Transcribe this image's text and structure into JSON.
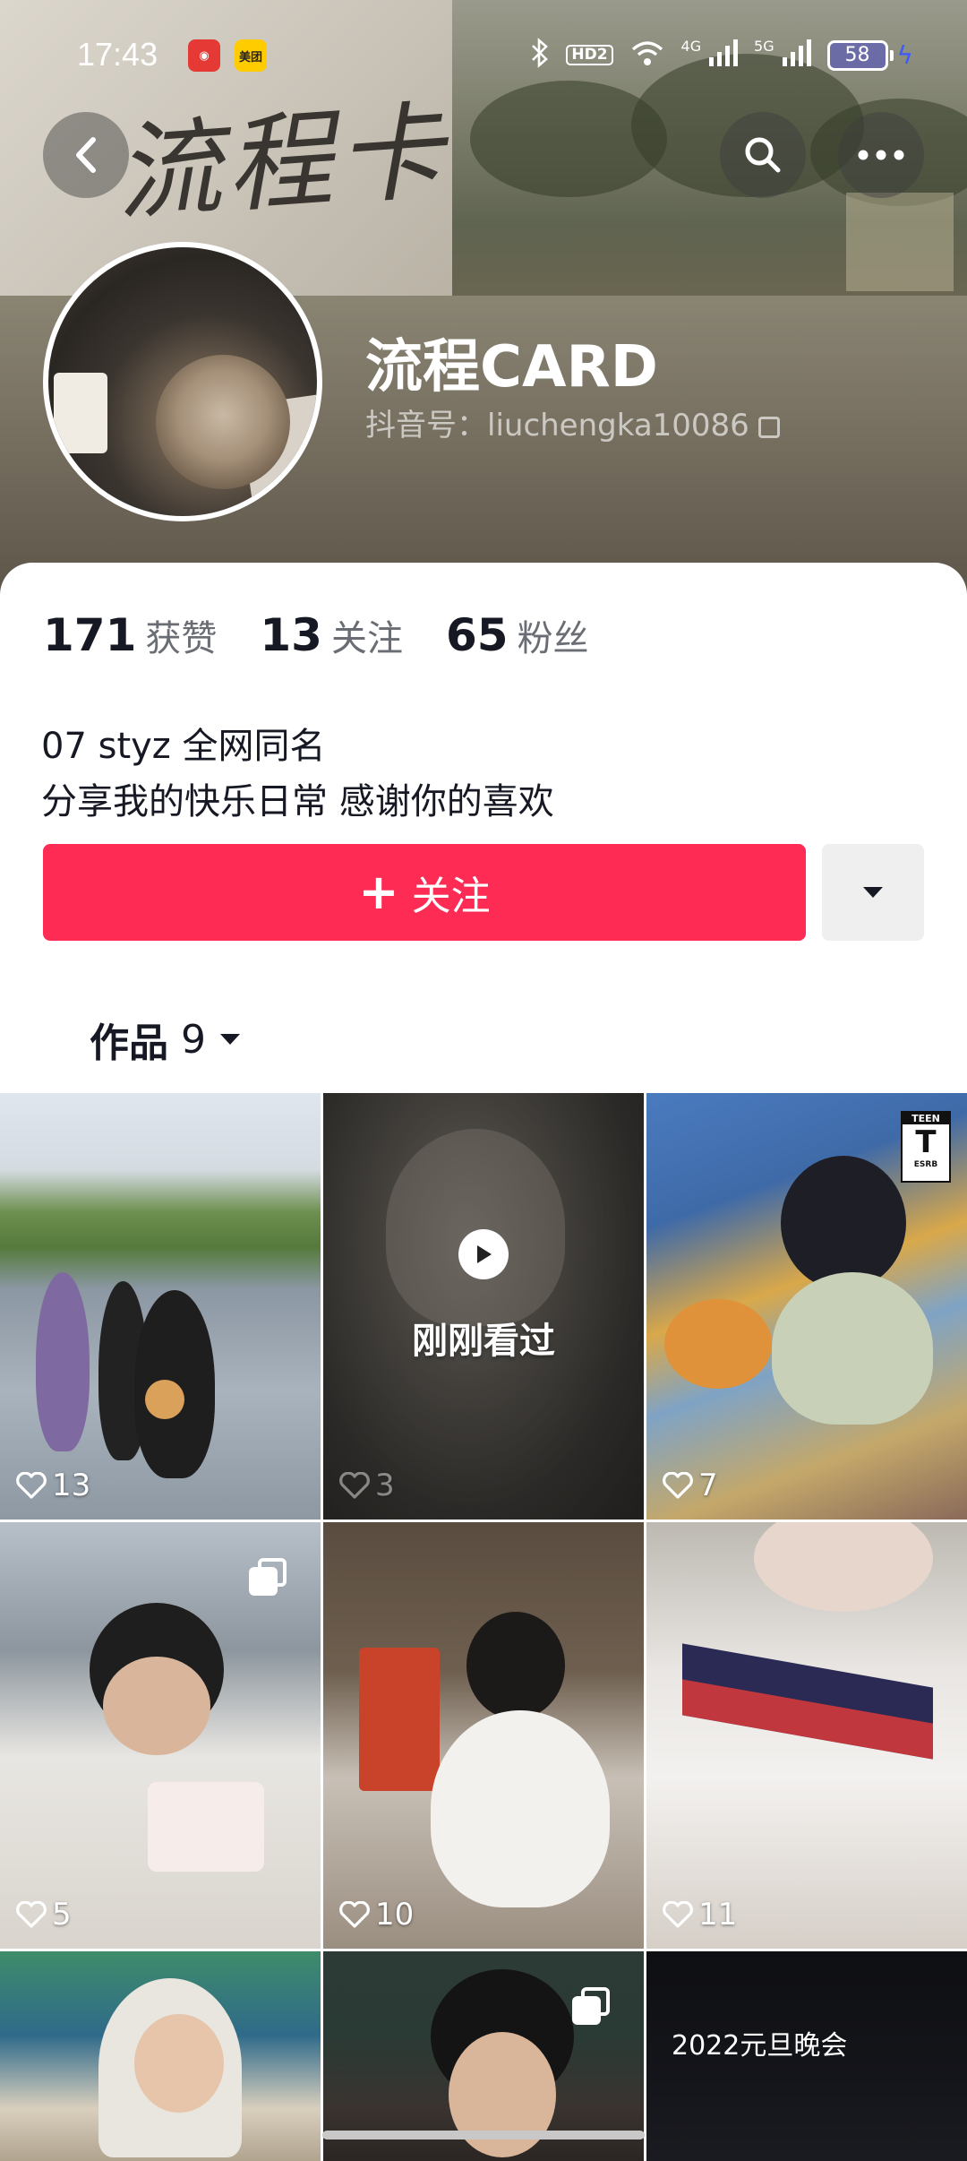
{
  "status_bar": {
    "time": "17:43",
    "app_badge_netease": "◉",
    "app_badge_meituan": "美团",
    "hd_label": "HD2",
    "net_4g": "4G",
    "net_5g": "5G",
    "battery_level": "58"
  },
  "header": {
    "banner_calligraphy": "流程卡"
  },
  "profile": {
    "nickname": "流程CARD",
    "handle": "抖音号：liuchengka10086",
    "stats": [
      {
        "value": "171",
        "label": "获赞"
      },
      {
        "value": "13",
        "label": "关注"
      },
      {
        "value": "65",
        "label": "粉丝"
      }
    ],
    "bio_line1": "07 styz 全网同名",
    "bio_line2": "分享我的快乐日常 感谢你的喜欢"
  },
  "actions": {
    "follow_label": "关注",
    "follow_plus": "+"
  },
  "tabs": {
    "works_label": "作品",
    "works_count": "9"
  },
  "grid": {
    "watched_label": "刚刚看过",
    "items": [
      {
        "likes": "13"
      },
      {
        "likes": "3"
      },
      {
        "likes": "7"
      },
      {
        "likes": "5"
      },
      {
        "likes": "10"
      },
      {
        "likes": "11"
      },
      {
        "likes": ""
      },
      {
        "likes": ""
      },
      {
        "likes": ""
      }
    ],
    "rating_tag": "TEEN T ESRB",
    "event_title": "2022元旦晚会"
  },
  "colors": {
    "follow_button": "#fe2c55",
    "text_primary": "#161823",
    "text_secondary": "#6b6d75"
  }
}
